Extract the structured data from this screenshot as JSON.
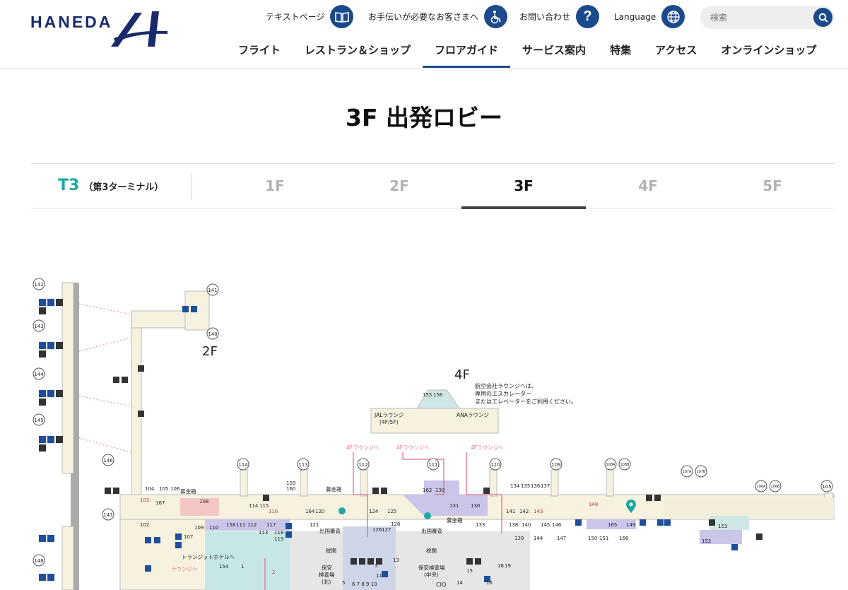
{
  "header": {
    "logo_text": "HANEDA",
    "utility": {
      "text_page_label": "テキストページ",
      "assistance_label": "お手伝いが必要なお客さまへ",
      "contact_label": "お問い合わせ",
      "language_label": "Language"
    },
    "search": {
      "placeholder": "検索"
    },
    "nav": [
      "フライト",
      "レストラン＆ショップ",
      "フロアガイド",
      "サービス案内",
      "特集",
      "アクセス",
      "オンラインショップ"
    ],
    "active_nav": "フロアガイド",
    "brand_color": "#1b4a8c"
  },
  "page_title": "3F 出発ロビー",
  "tabs": {
    "terminal": "T3",
    "terminal_sub": "（第3ターミナル）",
    "floors": [
      "1F",
      "2F",
      "3F",
      "4F",
      "5F"
    ],
    "active_floor": "3F",
    "accent_color": "#1fa7a7"
  },
  "map": {
    "floor_2": "2F",
    "floor_4": "4F",
    "lounge_note": [
      "航空会社ラウンジへは、",
      "専用のエスカレーター",
      "またはエレベーターをご利用ください。"
    ],
    "jal_lounge": [
      "JALラウンジ",
      "(4F/5F)"
    ],
    "ana_lounge": "ANAラウンジ",
    "to_4f_lounge": "4Fラウンジへ",
    "to_lounge": "ラウンジへ",
    "to_transit_hotel": "トランジットホテルへ",
    "donation_box": "募金箱",
    "immigration": "出国審査",
    "customs": "税関",
    "security_north": [
      "保安",
      "検査場",
      "(北)"
    ],
    "security_center": [
      "保安検査場",
      "(中央)"
    ],
    "cig": "CIQ",
    "gates": [
      "142",
      "143",
      "144",
      "145",
      "146",
      "147",
      "148",
      "141",
      "140",
      "114",
      "113",
      "112",
      "111",
      "110",
      "109",
      "108A",
      "108B",
      "107A",
      "107B",
      "106A",
      "106B",
      "105"
    ],
    "rooms": [
      "159",
      "160",
      "104",
      "105",
      "106",
      "103",
      "167",
      "108",
      "114",
      "115",
      "116",
      "164",
      "120",
      "124",
      "125",
      "162",
      "130",
      "131",
      "130",
      "134",
      "135",
      "136",
      "137",
      "141",
      "142",
      "143",
      "148",
      "102",
      "110",
      "158",
      "111",
      "112",
      "117",
      "113",
      "118",
      "119",
      "121",
      "126",
      "127",
      "128",
      "133",
      "138",
      "140",
      "145",
      "146",
      "165",
      "149",
      "153",
      "109",
      "107",
      "139",
      "144",
      "147",
      "150",
      "151",
      "166",
      "152",
      "154",
      "1",
      "2",
      "13",
      "3",
      "18",
      "19",
      "15",
      "16",
      "14",
      "155",
      "156",
      "11",
      "6 7 8 9 10",
      "5"
    ]
  }
}
